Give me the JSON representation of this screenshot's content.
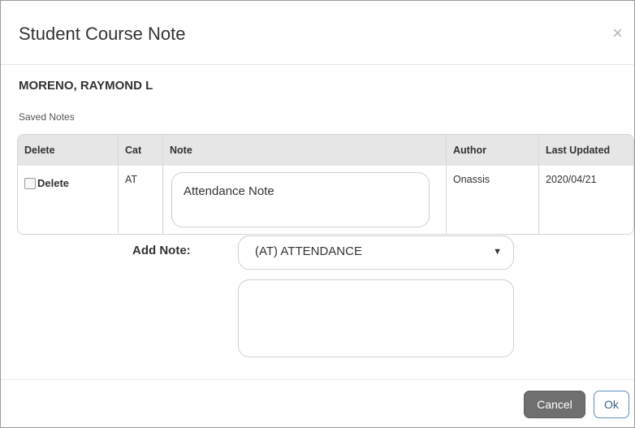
{
  "modal": {
    "title": "Student Course Note",
    "close_icon": "×"
  },
  "student": {
    "name": "MORENO, RAYMOND L"
  },
  "saved_notes": {
    "label": "Saved Notes",
    "columns": [
      "Delete",
      "Cat",
      "Note",
      "Author",
      "Last Updated"
    ],
    "rows": [
      {
        "delete_label": "Delete",
        "delete_checked": false,
        "cat": "AT",
        "note": "Attendance Note",
        "author": "Onassis",
        "last_updated": "2020/04/21"
      }
    ]
  },
  "add_note": {
    "label": "Add Note:",
    "selected_category": "(AT) ATTENDANCE",
    "caret": "▼",
    "note_text": ""
  },
  "footer": {
    "cancel_label": "Cancel",
    "ok_label": "Ok"
  },
  "colors": {
    "cancel_bg": "#6f6f6f",
    "ok_border": "#5b8cc2",
    "header_bg": "#e6e6e6"
  }
}
